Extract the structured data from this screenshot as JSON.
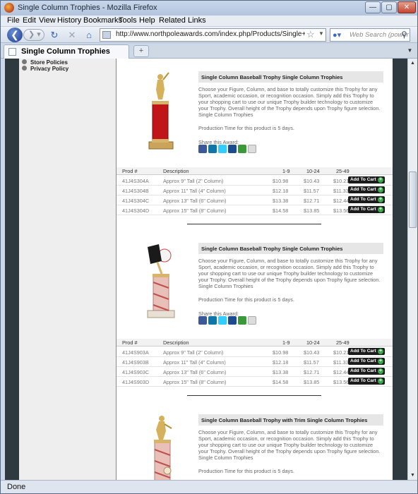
{
  "window": {
    "title": "Single Column Trophies - Mozilla Firefox",
    "minimize_icon": "minimize-icon",
    "maximize_icon": "maximize-icon",
    "close_icon": "close-icon"
  },
  "menu": [
    "File",
    "Edit",
    "View",
    "History",
    "Bookmarks",
    "Tools",
    "Help",
    "Related Links"
  ],
  "nav": {
    "url": "http://www.northpoleawards.com/index.php/Products/Single+Column",
    "search_placeholder": "Web Search (power"
  },
  "tab": {
    "label": "Single Column Trophies",
    "new_tab": "+"
  },
  "sidebar": {
    "links": [
      "Store Policies",
      "Privacy Policy"
    ]
  },
  "share_label": "Share this Award:",
  "production": "Production Time for this product is 5 days.",
  "description": "Choose your Figure, Column, and base to totally customize this Trophy for any Sport, academic occasion, or recognition occasion. Simply add this Trophy to your shopping cart to use our unique Trophy builder technology to customize your Trophy. Overall height of the Trophy depends upon Trophy figure selection. Single Column Trophies",
  "table_headers": {
    "prod": "Prod #",
    "desc": "Description",
    "p1": "1-9",
    "p2": "10-24",
    "p3": "25-49"
  },
  "add_to_cart": "Add To Cart",
  "products": [
    {
      "title": "Single Column Baseball Trophy Single Column Trophies",
      "rows": [
        {
          "id": "41J4S304A",
          "desc": "Approx 9\" Tall (2\" Column)",
          "p1": "$10.98",
          "p2": "$10.43",
          "p3": "$10.21"
        },
        {
          "id": "41J4S304B",
          "desc": "Approx 11\" Tall (4\" Column)",
          "p1": "$12.18",
          "p2": "$11.57",
          "p3": "$11.33"
        },
        {
          "id": "41J4S304C",
          "desc": "Approx 13\" Tall (6\" Column)",
          "p1": "$13.38",
          "p2": "$12.71",
          "p3": "$12.44"
        },
        {
          "id": "41J4S304D",
          "desc": "Approx 15\" Tall (8\" Column)",
          "p1": "$14.58",
          "p2": "$13.85",
          "p3": "$13.56"
        }
      ]
    },
    {
      "title": "Single Column Baseball Trophy Single Column Trophies",
      "rows": [
        {
          "id": "41J4S903A",
          "desc": "Approx 9\" Tall (2\" Column)",
          "p1": "$10.98",
          "p2": "$10.43",
          "p3": "$10.21"
        },
        {
          "id": "41J4S903B",
          "desc": "Approx 11\" Tall (4\" Column)",
          "p1": "$12.18",
          "p2": "$11.57",
          "p3": "$11.33"
        },
        {
          "id": "41J4S903C",
          "desc": "Approx 13\" Tall (6\" Column)",
          "p1": "$13.38",
          "p2": "$12.71",
          "p3": "$12.44"
        },
        {
          "id": "41J4S903D",
          "desc": "Approx 15\" Tall (8\" Column)",
          "p1": "$14.58",
          "p2": "$13.85",
          "p3": "$13.56"
        }
      ]
    },
    {
      "title": "Single Column Baseball Trophy with Trim Single Column Trophies",
      "rows": []
    }
  ],
  "status": "Done"
}
